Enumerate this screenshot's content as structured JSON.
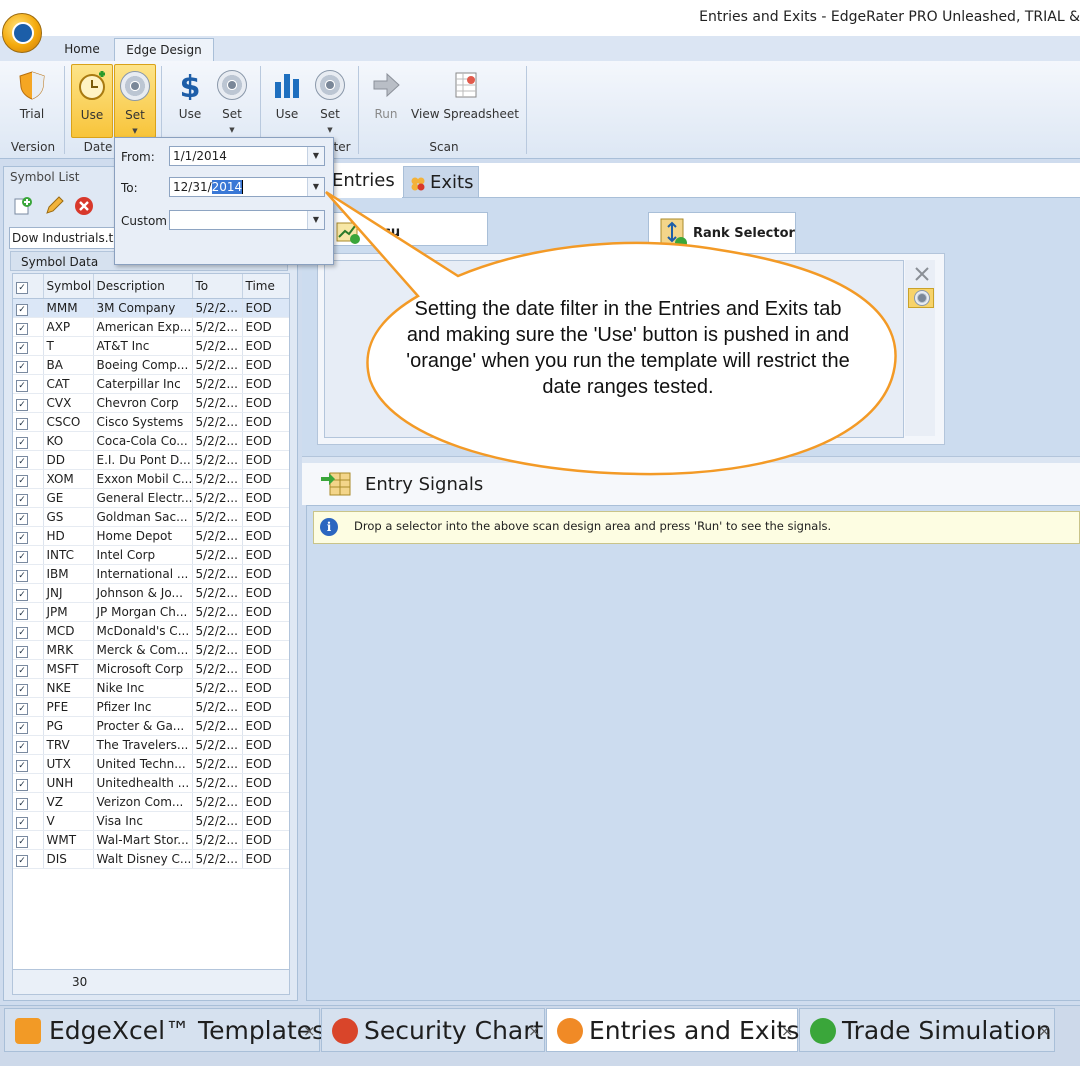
{
  "window": {
    "title": "Entries and Exits - EdgeRater PRO Unleashed, TRIAL &"
  },
  "ribbon": {
    "tabs": [
      {
        "label": "Home"
      },
      {
        "label": "Edge Design"
      }
    ],
    "buttons": {
      "trial": "Trial",
      "date_use": "Use",
      "date_set": "Set",
      "price_use": "Use",
      "price_set": "Set",
      "volume_use": "Use",
      "volume_set": "Set",
      "run": "Run",
      "view_spreadsheet": "View Spreadsheet"
    },
    "groups": {
      "version": "Version",
      "date": "Date",
      "filter_partial": "ter",
      "scan": "Scan"
    }
  },
  "date_popup": {
    "from_label": "From:",
    "from_value": "1/1/2014",
    "to_label": "To:",
    "to_value_prefix": "12/31/",
    "to_value_selected": "2014",
    "custom_label": "Custom",
    "custom_value": ""
  },
  "symbol_list": {
    "title": "Symbol List",
    "file": "Dow Industrials.txt",
    "data_header": "Symbol Data",
    "columns": [
      "Symbol",
      "Description",
      "To",
      "Time"
    ],
    "rows": [
      [
        "MMM",
        "3M Company",
        "5/2/2...",
        "EOD"
      ],
      [
        "AXP",
        "American Exp...",
        "5/2/2...",
        "EOD"
      ],
      [
        "T",
        "AT&T Inc",
        "5/2/2...",
        "EOD"
      ],
      [
        "BA",
        "Boeing Comp...",
        "5/2/2...",
        "EOD"
      ],
      [
        "CAT",
        "Caterpillar Inc",
        "5/2/2...",
        "EOD"
      ],
      [
        "CVX",
        "Chevron Corp",
        "5/2/2...",
        "EOD"
      ],
      [
        "CSCO",
        "Cisco Systems",
        "5/2/2...",
        "EOD"
      ],
      [
        "KO",
        "Coca-Cola Co...",
        "5/2/2...",
        "EOD"
      ],
      [
        "DD",
        "E.I. Du Pont D...",
        "5/2/2...",
        "EOD"
      ],
      [
        "XOM",
        "Exxon Mobil C...",
        "5/2/2...",
        "EOD"
      ],
      [
        "GE",
        "General Electr...",
        "5/2/2...",
        "EOD"
      ],
      [
        "GS",
        "Goldman Sac...",
        "5/2/2...",
        "EOD"
      ],
      [
        "HD",
        "Home Depot",
        "5/2/2...",
        "EOD"
      ],
      [
        "INTC",
        "Intel Corp",
        "5/2/2...",
        "EOD"
      ],
      [
        "IBM",
        "International ...",
        "5/2/2...",
        "EOD"
      ],
      [
        "JNJ",
        "Johnson & Jo...",
        "5/2/2...",
        "EOD"
      ],
      [
        "JPM",
        "JP Morgan Ch...",
        "5/2/2...",
        "EOD"
      ],
      [
        "MCD",
        "McDonald's C...",
        "5/2/2...",
        "EOD"
      ],
      [
        "MRK",
        "Merck & Com...",
        "5/2/2...",
        "EOD"
      ],
      [
        "MSFT",
        "Microsoft Corp",
        "5/2/2...",
        "EOD"
      ],
      [
        "NKE",
        "Nike Inc",
        "5/2/2...",
        "EOD"
      ],
      [
        "PFE",
        "Pfizer Inc",
        "5/2/2...",
        "EOD"
      ],
      [
        "PG",
        "Procter & Ga...",
        "5/2/2...",
        "EOD"
      ],
      [
        "TRV",
        "The Travelers...",
        "5/2/2...",
        "EOD"
      ],
      [
        "UTX",
        "United Techn...",
        "5/2/2...",
        "EOD"
      ],
      [
        "UNH",
        "Unitedhealth ...",
        "5/2/2...",
        "EOD"
      ],
      [
        "VZ",
        "Verizon Com...",
        "5/2/2...",
        "EOD"
      ],
      [
        "V",
        "Visa Inc",
        "5/2/2...",
        "EOD"
      ],
      [
        "WMT",
        "Wal-Mart Stor...",
        "5/2/2...",
        "EOD"
      ],
      [
        "DIS",
        "Walt Disney C...",
        "5/2/2...",
        "EOD"
      ]
    ],
    "count": "30"
  },
  "main": {
    "tabs": {
      "entries": "Entries",
      "exits": "Exits"
    },
    "security_tab_partial": "Secu",
    "rank_selector": "Rank Selector",
    "entry_signals_title": "Entry Signals",
    "info_message": "Drop a selector into the above scan design area and press 'Run' to see the signals.",
    "callout": "Setting the date filter in the Entries and Exits tab and making sure the 'Use' button is pushed in and 'orange' when you run the template will restrict the date ranges tested."
  },
  "bottom_tabs": [
    {
      "label": "EdgeXcel™ Templates",
      "close": "×"
    },
    {
      "label": "Security Chart",
      "close": "×"
    },
    {
      "label": "Entries and Exits",
      "close": "×"
    },
    {
      "label": "Trade Simulation",
      "close": "×"
    }
  ],
  "colors": {
    "accent_orange": "#f39a26",
    "pressed_yellow": "#f8c43a",
    "ribbon_blue": "#dbe5f3"
  }
}
